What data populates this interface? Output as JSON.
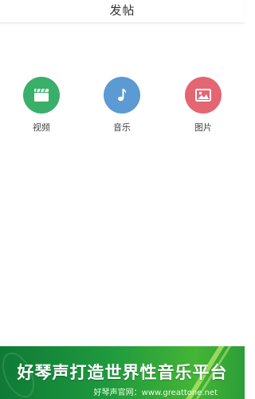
{
  "header": {
    "title": "发帖"
  },
  "options": [
    {
      "label": "视频",
      "icon": "clapperboard-icon",
      "color": "#3aaf6a"
    },
    {
      "label": "音乐",
      "icon": "music-note-icon",
      "color": "#5b9ad3"
    },
    {
      "label": "图片",
      "icon": "picture-icon",
      "color": "#e46672"
    }
  ],
  "banner": {
    "slogan": "好琴声打造世界性音乐平台",
    "site": "好琴声官网：www.greattone.net",
    "accent_color": "#1f9a3e"
  }
}
